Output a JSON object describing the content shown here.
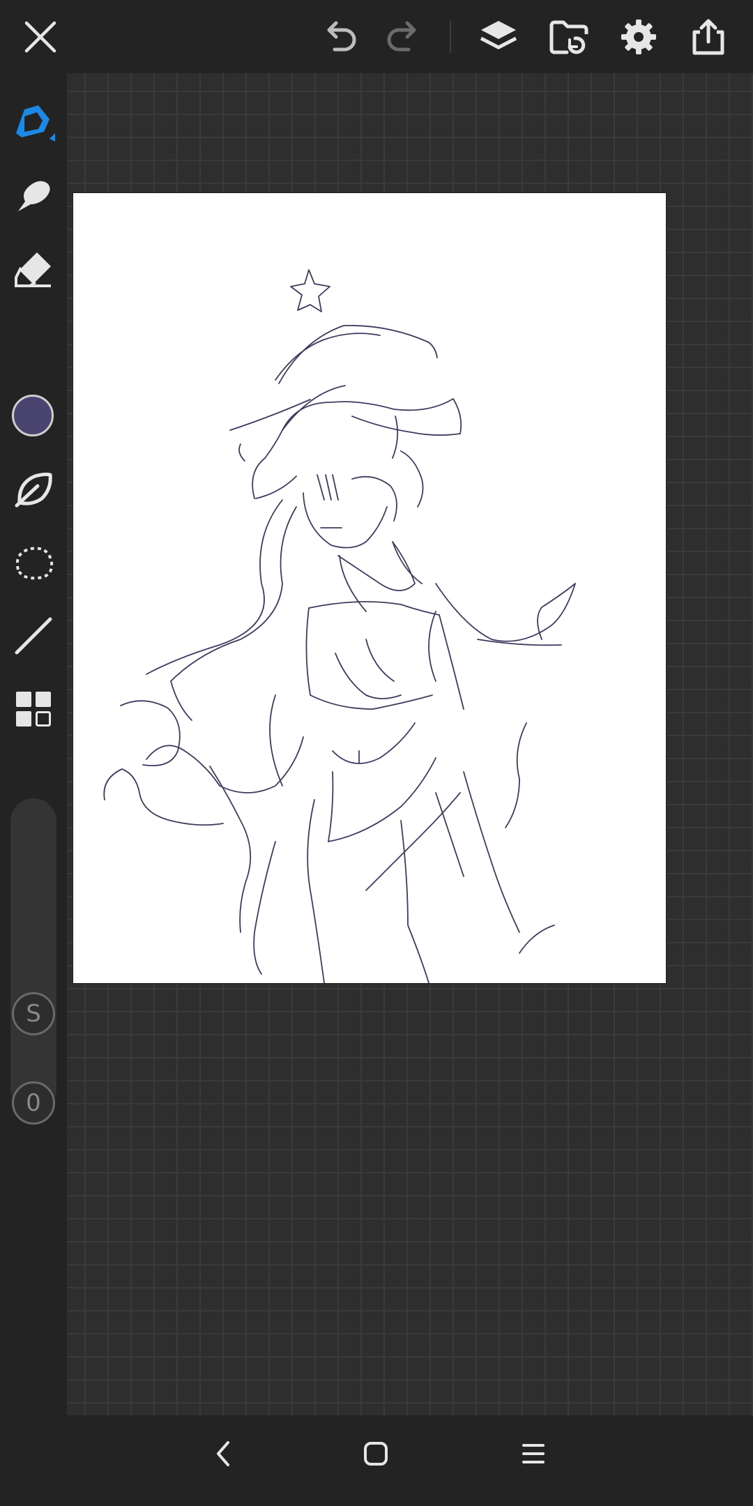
{
  "app": {
    "accent_color": "#1e88e5",
    "brush_color": "#4a4470"
  },
  "topbar": {
    "icons": [
      "close-icon",
      "undo-icon",
      "redo-icon",
      "layers-icon",
      "gallery-folder-icon",
      "gear-icon",
      "share-icon"
    ]
  },
  "sidebar": {
    "tools": [
      "pen-icon",
      "smudge-icon",
      "eraser-icon",
      "color-picker",
      "leaf-brush-icon",
      "lasso-icon",
      "line-icon",
      "grid-icon"
    ],
    "size_slider_label": "S",
    "opacity_slider_label": "0"
  },
  "navbar": {
    "icons": [
      "back-icon",
      "home-icon",
      "recents-icon"
    ]
  }
}
